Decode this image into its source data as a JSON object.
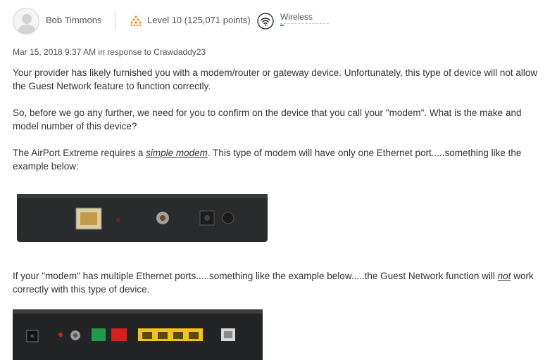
{
  "author": {
    "name": "Bob Timmons",
    "level": "Level 10",
    "points": "(125,071 points)",
    "category": "Wireless"
  },
  "post_meta": {
    "timestamp": "Mar 15, 2018 9:37 AM",
    "in_response_to_prefix": "in response to",
    "reply_to_user": "Crawdaddy23"
  },
  "body": {
    "p1": "Your provider has likely furnished you with a modem/router or gateway device. Unfortunately, this type of device will not allow the Guest Network feature to function correctly.",
    "p2": "So, before we go any further, we need for you to confirm on the device that you call your \"modem\".  What is the make and model number of this device?",
    "p3_before": "The AirPort Extreme requires a ",
    "p3_emph": "simple modem",
    "p3_after": ". This type of modem will have only one Ethernet port.....something like the example below:",
    "p4_before": "If your \"modem\" has multiple Ethernet ports.....something like the example below.....the Guest Network function will ",
    "p4_emph": "not",
    "p4_after": " work correctly with this type of device."
  },
  "icons": {
    "avatar": "user-avatar-icon",
    "level": "level-pyramid-icon",
    "category": "wifi-icon"
  },
  "colors": {
    "level_icon": "#f08a24",
    "link_accent": "#2a8ad4",
    "ethernet_yellow": "#f2c318",
    "dsl_green": "#1f9a4a",
    "wan_red": "#d62020"
  }
}
